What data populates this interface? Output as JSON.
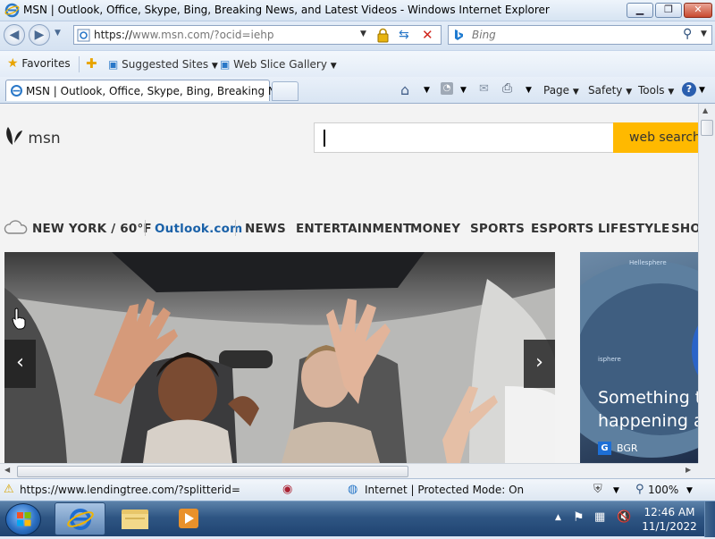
{
  "window": {
    "title": "MSN | Outlook, Office, Skype, Bing, Breaking News, and Latest Videos - Windows Internet Explorer",
    "minimize": "▁",
    "maximize": "❐",
    "close": "✕"
  },
  "address_bar": {
    "url_prefix": "https://",
    "url_rest": "www.msn.com/?ocid=iehp",
    "search_placeholder": "Bing"
  },
  "favorites_bar": {
    "favorites": "Favorites",
    "suggested_sites": "Suggested Sites",
    "web_slice_gallery": "Web Slice Gallery"
  },
  "tabs": [
    {
      "label": "MSN | Outlook, Office, Skype, Bing, Breaking Ne..."
    }
  ],
  "command_bar": {
    "page": "Page",
    "safety": "Safety",
    "tools": "Tools"
  },
  "msn": {
    "logo": "msn",
    "web_search": "web search",
    "weather": "NEW YORK / 60°F",
    "nav": [
      "Outlook.com",
      "NEWS",
      "ENTERTAINMENT",
      "MONEY",
      "SPORTS",
      "ESPORTS",
      "LIFESTYLE",
      "SHO"
    ],
    "side_story": {
      "headline_line1": "Something to",
      "headline_line2": "happening at",
      "source": "BGR",
      "image_caption": "Hellesphere"
    }
  },
  "status_bar": {
    "link": "https://www.lendingtree.com/?splitterid=",
    "zone": "Internet | Protected Mode: On",
    "zoom": "100%"
  },
  "taskbar": {
    "time": "12:46 AM",
    "date": "11/1/2022"
  },
  "colors": {
    "accent_search": "#ffb900",
    "outlook_link": "#1a61a8",
    "taskbar": "#2f5684"
  }
}
